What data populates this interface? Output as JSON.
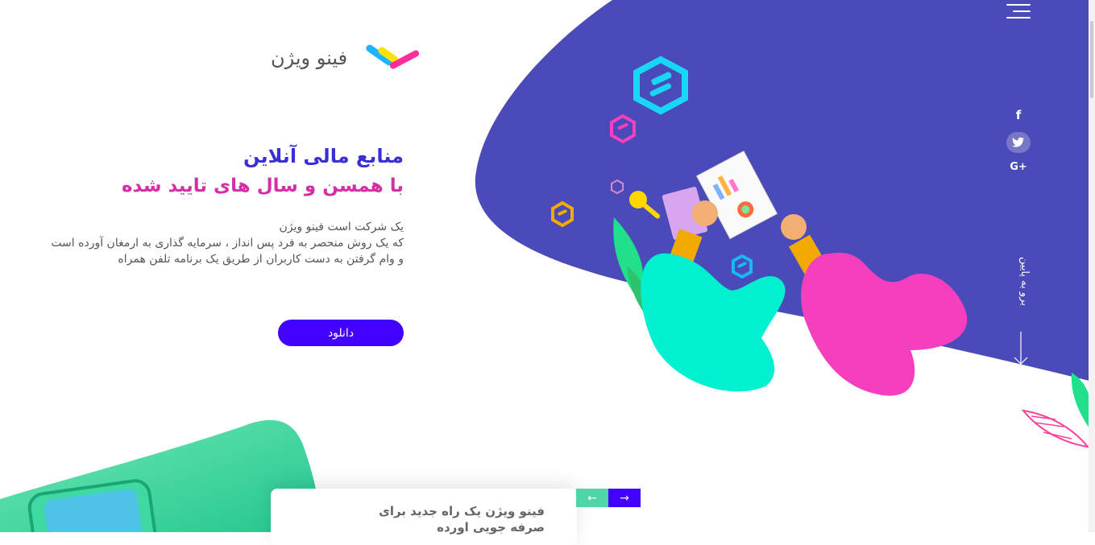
{
  "brand": {
    "name": "فینو ویژن",
    "colors": {
      "primary": "#4200ff",
      "accent_pink": "#d62fa6",
      "title_blue": "#3a2fd6",
      "blob": "#4a4ab8",
      "teal": "#00f0d0",
      "magenta": "#f53fbf"
    }
  },
  "header": {
    "menu_icon": "hamburger-menu-icon"
  },
  "hero": {
    "title": "منابع مالی آنلاین",
    "subtitle": "با همسن و سال های تایید شده",
    "description_lines": [
      "یک شرکت  است فینو ویژن",
      "که یک روش منحصر به فرد پس انداز ، سرمایه گذاری به ارمغان آورده است",
      "و وام گرفتن به دست کاربران از طریق یک برنامه تلفن همراه"
    ],
    "download_label": "دانلود"
  },
  "social": {
    "facebook": "f",
    "twitter_icon": "twitter-bird-icon",
    "google_plus": "G+"
  },
  "side": {
    "scroll_label": "برو به پایین",
    "arrow_icon": "arrow-down-icon"
  },
  "card": {
    "title_line1": "فینو ویژن یک راه جدید برای",
    "title_line2": "صرفه جویی اورده"
  },
  "slider": {
    "prev_label": "←",
    "next_label": "→"
  }
}
